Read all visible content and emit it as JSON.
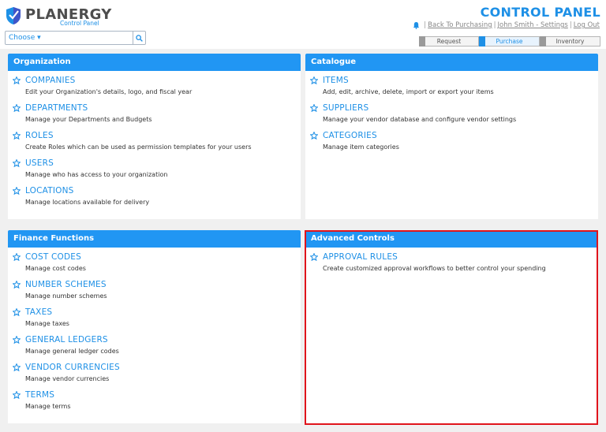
{
  "brand": {
    "name": "PLANERGY",
    "subtitle": "Control Panel"
  },
  "search": {
    "choose_label": "Choose ▾"
  },
  "header": {
    "title": "CONTROL PANEL",
    "links": [
      "Back To Purchasing",
      "John Smith - Settings",
      "Log Out"
    ],
    "separator": "|"
  },
  "tabs": [
    {
      "label": "Request",
      "active": false
    },
    {
      "label": "Purchase",
      "active": true
    },
    {
      "label": "Inventory",
      "active": false
    }
  ],
  "panels": [
    {
      "title": "Organization",
      "items": [
        {
          "name": "COMPANIES",
          "desc": "Edit your Organization's details, logo, and fiscal year"
        },
        {
          "name": "DEPARTMENTS",
          "desc": "Manage your Departments and Budgets"
        },
        {
          "name": "ROLES",
          "desc": "Create Roles which can be used as permission templates for your users"
        },
        {
          "name": "USERS",
          "desc": "Manage who has access to your organization"
        },
        {
          "name": "LOCATIONS",
          "desc": "Manage locations available for delivery"
        }
      ]
    },
    {
      "title": "Catalogue",
      "items": [
        {
          "name": "ITEMS",
          "desc": "Add, edit, archive, delete, import or export your items"
        },
        {
          "name": "SUPPLIERS",
          "desc": "Manage your vendor database and configure vendor settings"
        },
        {
          "name": "CATEGORIES",
          "desc": "Manage item categories"
        }
      ]
    },
    {
      "title": "Finance Functions",
      "items": [
        {
          "name": "COST CODES",
          "desc": "Manage cost codes"
        },
        {
          "name": "NUMBER SCHEMES",
          "desc": "Manage number schemes"
        },
        {
          "name": "TAXES",
          "desc": "Manage taxes"
        },
        {
          "name": "GENERAL LEDGERS",
          "desc": "Manage general ledger codes"
        },
        {
          "name": "VENDOR CURRENCIES",
          "desc": "Manage vendor currencies"
        },
        {
          "name": "TERMS",
          "desc": "Manage terms"
        }
      ]
    },
    {
      "title": "Advanced Controls",
      "items": [
        {
          "name": "APPROVAL RULES",
          "desc": "Create customized approval workflows to better control your spending"
        }
      ]
    }
  ],
  "icons": {
    "logo": "shield-logo-icon",
    "search": "search-icon",
    "notifications": "bell-icon",
    "item": "star-outline-icon"
  },
  "colors": {
    "accent": "#1e90e6",
    "panel_header": "#2196f3",
    "highlight": "#e0141c"
  }
}
